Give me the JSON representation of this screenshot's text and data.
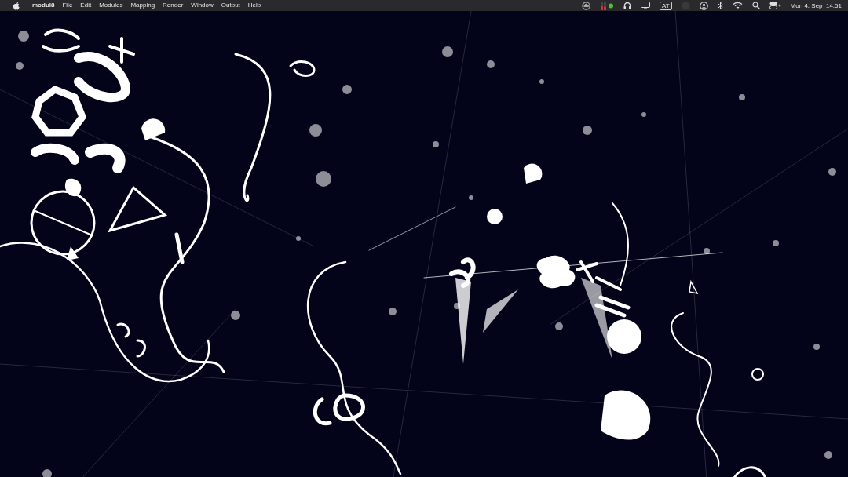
{
  "menu_bar": {
    "app_name": "modul8",
    "menus": [
      "File",
      "Edit",
      "Modules",
      "Mapping",
      "Render",
      "Window",
      "Output",
      "Help"
    ],
    "input_source": "AT",
    "clock": "Mon 4. Sep  14:51"
  }
}
